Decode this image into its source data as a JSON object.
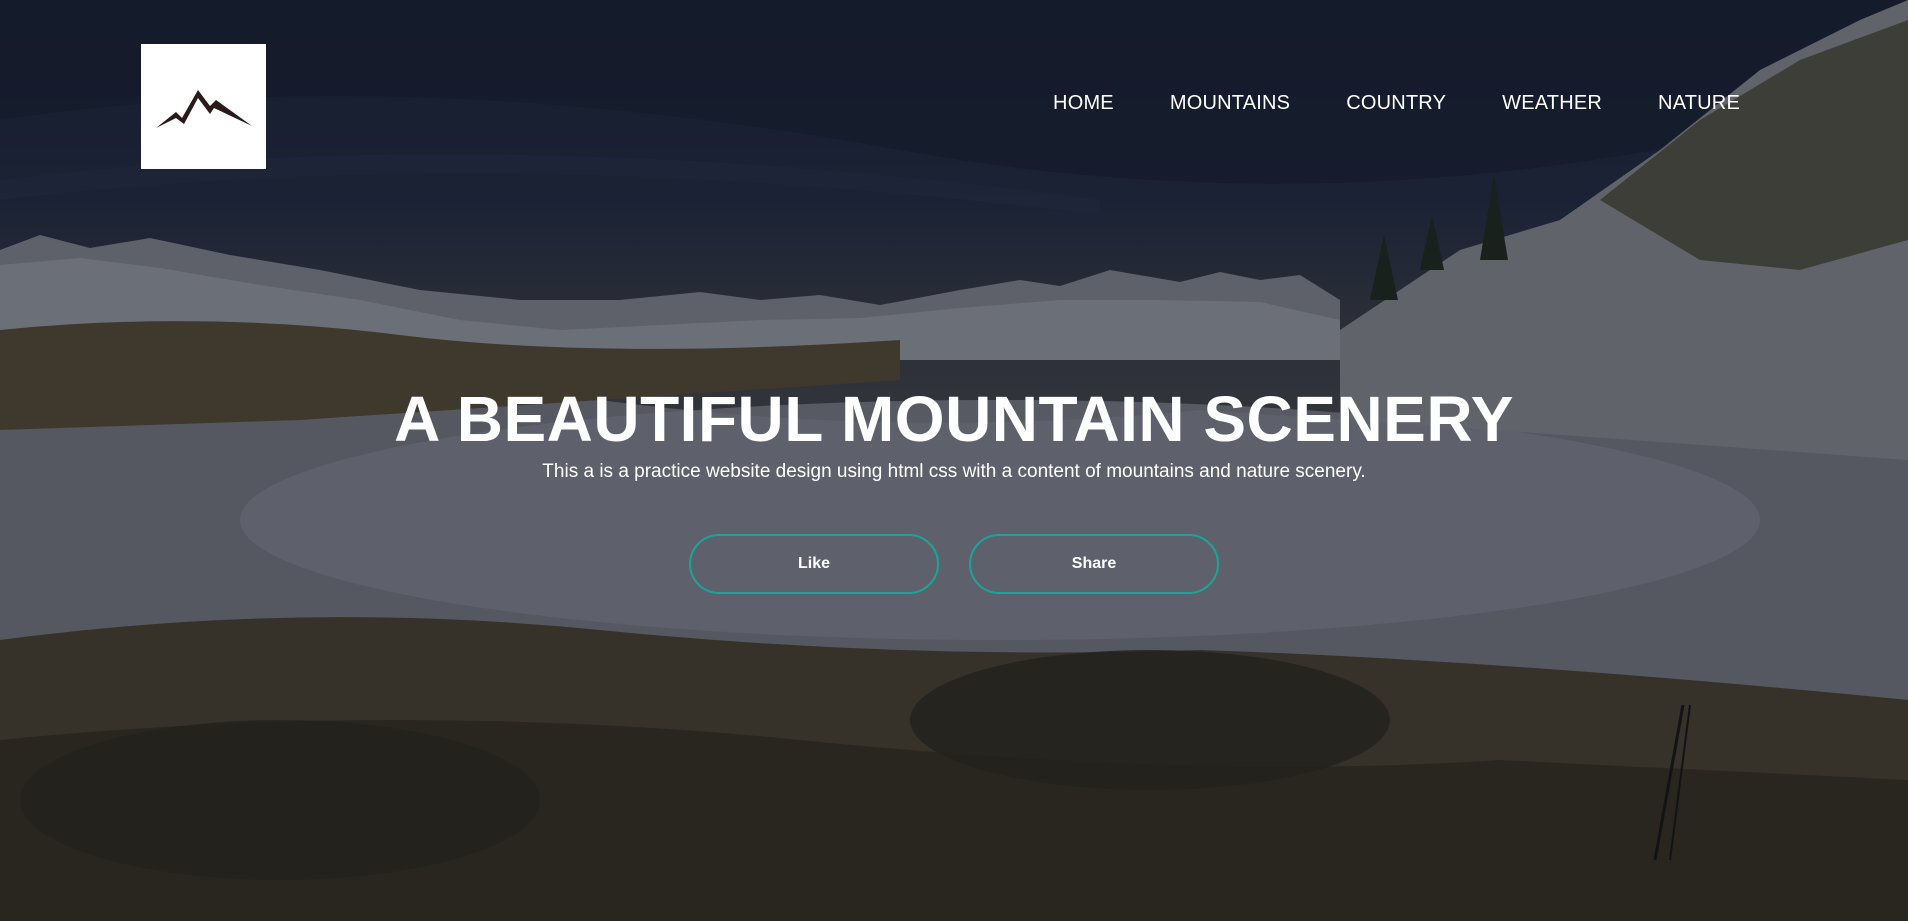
{
  "brand": {
    "logo_icon": "mountain-logo-icon",
    "logo_color": "#2a1a1a"
  },
  "nav": {
    "items": [
      {
        "label": "HOME"
      },
      {
        "label": "MOUNTAINS"
      },
      {
        "label": "COUNTRY"
      },
      {
        "label": "WEATHER"
      },
      {
        "label": "NATURE"
      }
    ]
  },
  "hero": {
    "title": "A BEAUTIFUL MOUNTAIN SCENERY",
    "subtitle": "This a is a practice website design using html css with a content of mountains and nature scenery.",
    "buttons": {
      "like_label": "Like",
      "share_label": "Share"
    }
  },
  "colors": {
    "accent": "#1aa59a",
    "text": "#ffffff"
  }
}
